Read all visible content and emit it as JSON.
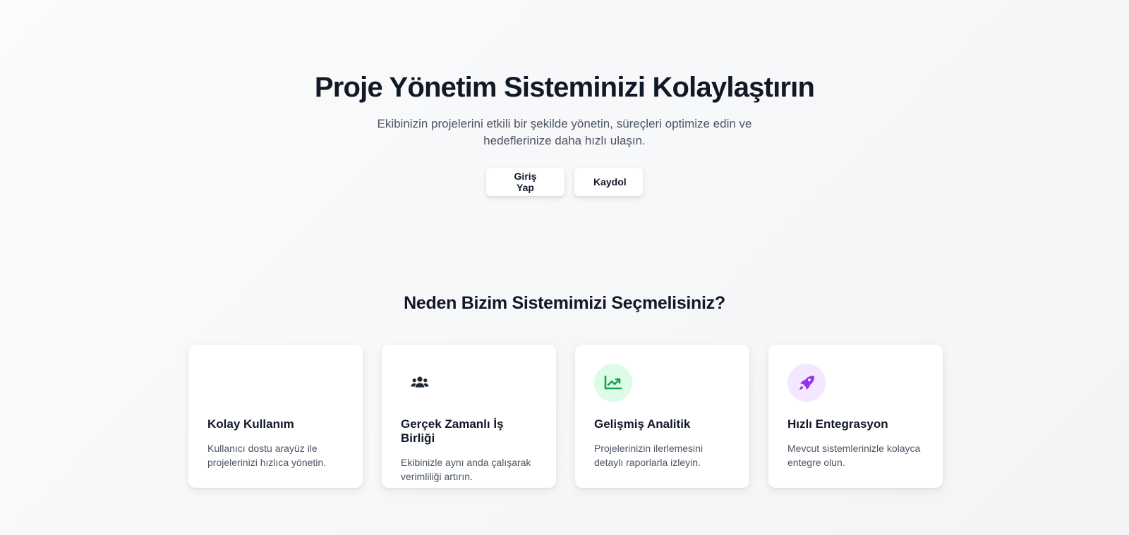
{
  "hero": {
    "title": "Proje Yönetim Sisteminizi Kolaylaştırın",
    "subtitle": "Ekibinizin projelerini etkili bir şekilde yönetin, süreçleri optimize edin ve hedeflerinize daha hızlı ulaşın.",
    "login_label": "Giriş Yap",
    "signup_label": "Kaydol"
  },
  "features": {
    "title": "Neden Bizim Sistemimizi Seçmelisiniz?",
    "items": [
      {
        "icon": "blank-icon",
        "title": "Kolay Kullanım",
        "description": "Kullanıcı dostu arayüz ile projelerinizi hızlıca yönetin.",
        "icon_bg": "#ffffff",
        "icon_color": "#ffffff"
      },
      {
        "icon": "users-icon",
        "title": "Gerçek Zamanlı İş Birliği",
        "description": "Ekibinizle aynı anda çalışarak verimliliği artırın.",
        "icon_bg": "#ffffff",
        "icon_color": "#1f2937"
      },
      {
        "icon": "chart-line-icon",
        "title": "Gelişmiş Analitik",
        "description": "Projelerinizin ilerlemesini detaylı raporlarla izleyin.",
        "icon_bg": "#dcfce7",
        "icon_color": "#16a34a"
      },
      {
        "icon": "rocket-icon",
        "title": "Hızlı Entegrasyon",
        "description": "Mevcut sistemlerinizle kolayca entegre olun.",
        "icon_bg": "#f3e8ff",
        "icon_color": "#9333ea"
      }
    ]
  }
}
